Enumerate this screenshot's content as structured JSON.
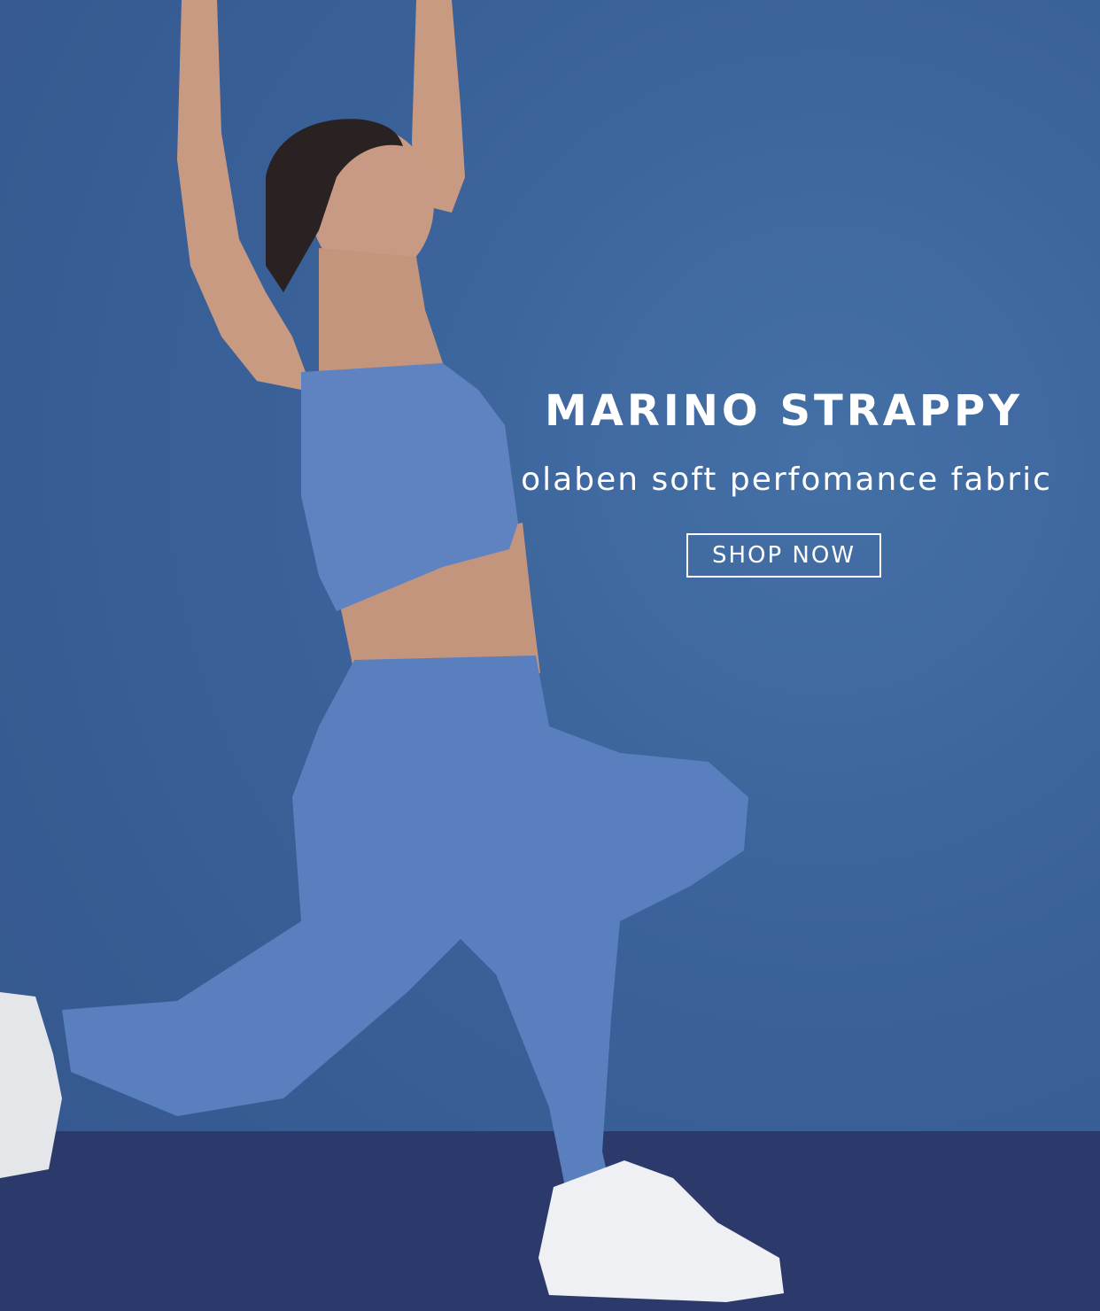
{
  "banner": {
    "title": "MARINO STRAPPY",
    "subtitle": "olaben soft perfomance fabric",
    "cta_label": "SHOP NOW"
  },
  "colors": {
    "background": "#3b5f97",
    "floor": "#2c3a6b",
    "outfit": "#5a7fbe",
    "text": "#ffffff"
  }
}
